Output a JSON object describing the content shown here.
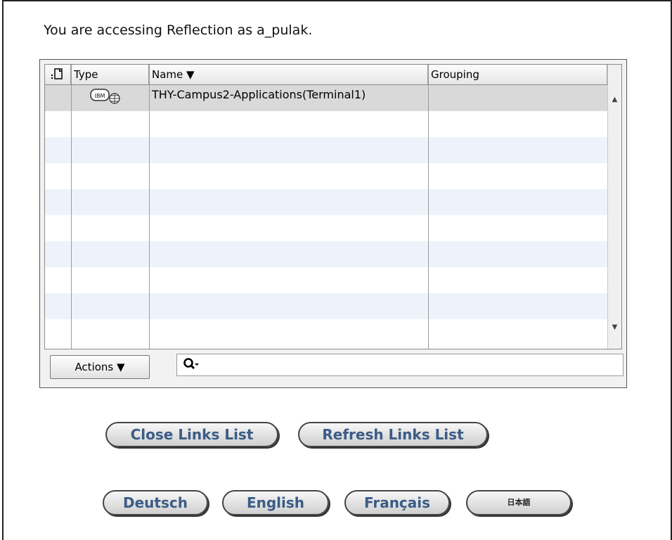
{
  "header": {
    "access_text": "You are accessing Reflection as a_pulak."
  },
  "table": {
    "columns": [
      {
        "key": "icon",
        "label": ""
      },
      {
        "key": "type",
        "label": "Type"
      },
      {
        "key": "name",
        "label": "Name ▼"
      },
      {
        "key": "grouping",
        "label": "Grouping"
      }
    ],
    "rows": [
      {
        "type_icon": "ibm-host-icon",
        "type_icon_text": "IBM",
        "name": "THY-Campus2-Applications(Terminal1)",
        "grouping": ""
      }
    ]
  },
  "toolbar": {
    "actions_label": "Actions ▼",
    "search_value": ""
  },
  "links_buttons": {
    "close": "Close Links List",
    "refresh": "Refresh Links List"
  },
  "languages": [
    "Deutsch",
    "English",
    "Français",
    "日本語"
  ],
  "colors": {
    "button_text": "#3b5c86",
    "row_alt": "#edf3fb",
    "row_selected": "#d9d9d9"
  }
}
